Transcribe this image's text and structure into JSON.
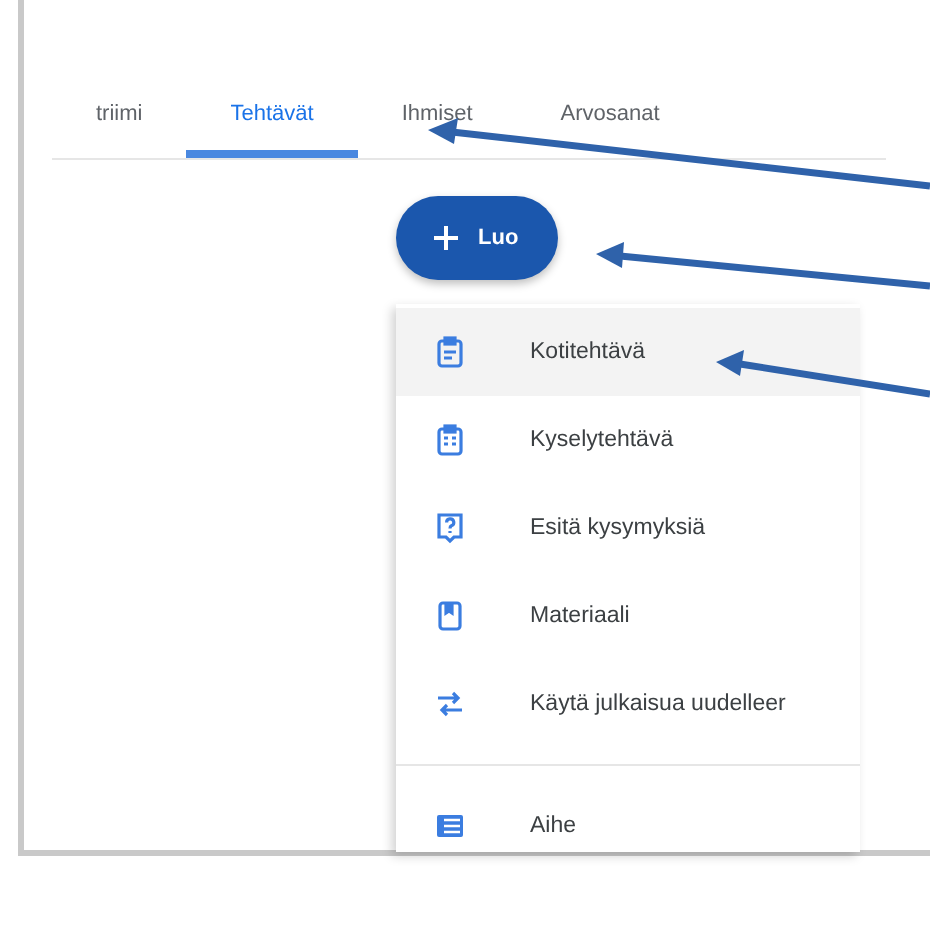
{
  "tabs": [
    {
      "label": "triimi",
      "selected": false
    },
    {
      "label": "Tehtävät",
      "selected": true
    },
    {
      "label": "Ihmiset",
      "selected": false
    },
    {
      "label": "Arvosanat",
      "selected": false
    }
  ],
  "create_button": {
    "label": "Luo"
  },
  "menu": {
    "groups": [
      {
        "items": [
          {
            "kind": "assignment",
            "label": "Kotitehtävä",
            "selected": true
          },
          {
            "kind": "quiz",
            "label": "Kyselytehtävä",
            "selected": false
          },
          {
            "kind": "question",
            "label": "Esitä kysymyksiä",
            "selected": false
          },
          {
            "kind": "material",
            "label": "Materiaali",
            "selected": false
          },
          {
            "kind": "reuse",
            "label": "Käytä julkaisua uudelleer",
            "selected": false
          }
        ]
      },
      {
        "items": [
          {
            "kind": "topic",
            "label": "Aihe",
            "selected": false
          }
        ]
      }
    ]
  }
}
